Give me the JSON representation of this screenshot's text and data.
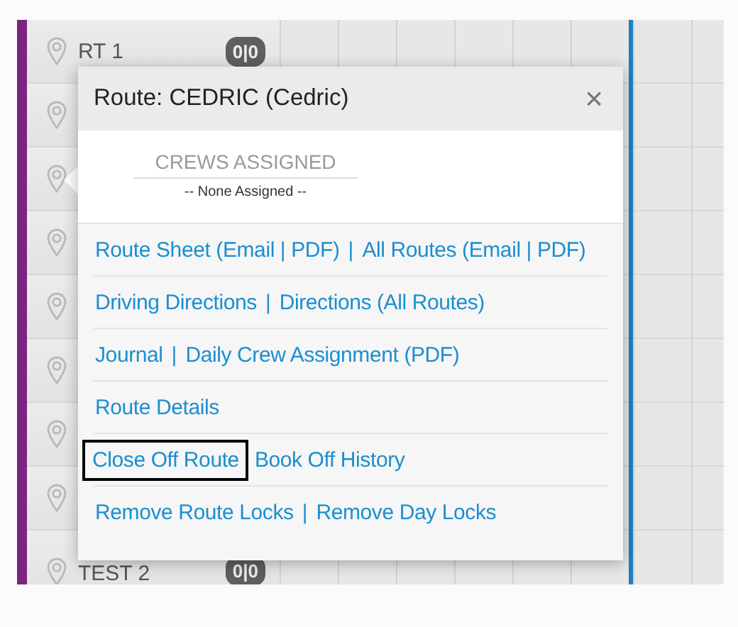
{
  "board": {
    "rows": [
      {
        "label": "RT 1",
        "badge": "0|0"
      },
      {},
      {},
      {},
      {},
      {},
      {},
      {},
      {
        "label": "TEST 2",
        "badge": "0|0"
      }
    ]
  },
  "popup": {
    "title": "Route: CEDRIC (Cedric)",
    "close": "×",
    "crews": {
      "heading": "CREWS ASSIGNED",
      "value": "-- None Assigned --"
    },
    "lines": [
      {
        "separator": "|",
        "links": [
          {
            "text": "Route Sheet (Email | PDF)",
            "focused": false
          },
          {
            "text": "All Routes (Email | PDF)",
            "focused": false
          }
        ]
      },
      {
        "separator": "|",
        "links": [
          {
            "text": "Driving Directions",
            "focused": false
          },
          {
            "text": "Directions (All Routes)",
            "focused": false
          }
        ]
      },
      {
        "separator": "|",
        "links": [
          {
            "text": "Journal",
            "focused": false
          },
          {
            "text": "Daily Crew Assignment (PDF)",
            "focused": false
          }
        ]
      },
      {
        "links": [
          {
            "text": "Route Details",
            "focused": false
          }
        ]
      },
      {
        "links": [
          {
            "text": "Close Off Route",
            "focused": true
          },
          {
            "text": "Book Off History",
            "focused": false
          }
        ]
      },
      {
        "separator": "|",
        "links": [
          {
            "text": "Remove Route Locks",
            "focused": false
          },
          {
            "text": "Remove Day Locks",
            "focused": false
          }
        ]
      }
    ]
  }
}
